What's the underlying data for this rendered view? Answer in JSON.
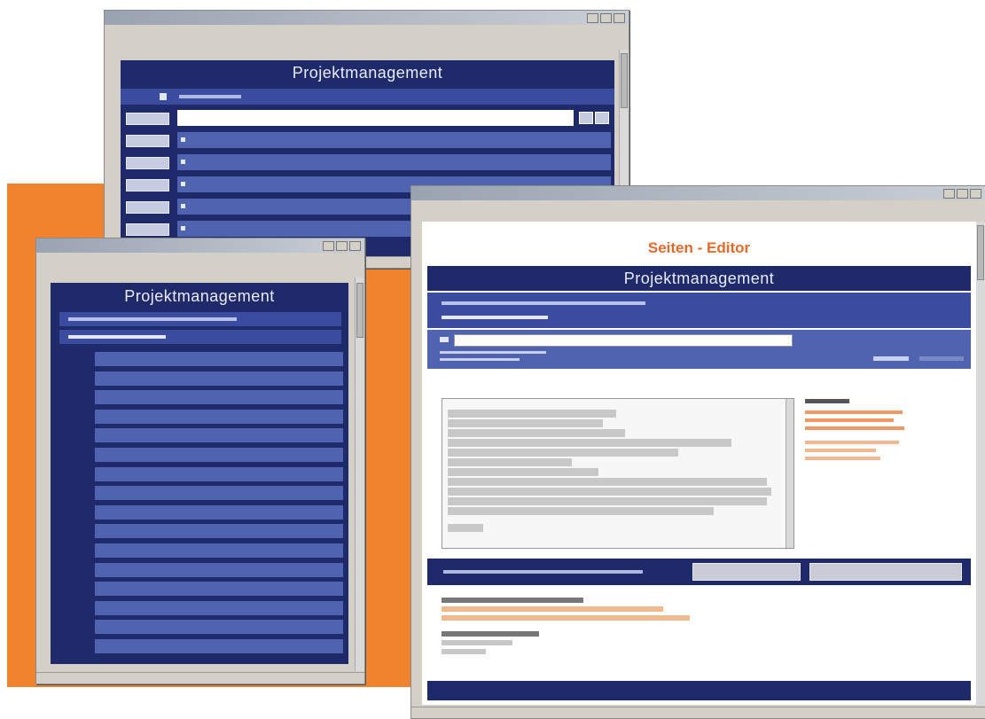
{
  "win_a": {
    "header": "Projektmanagement",
    "rows": [
      {
        "label": ""
      },
      {
        "label": ""
      },
      {
        "label": ""
      },
      {
        "label": ""
      },
      {
        "label": ""
      },
      {
        "label": ""
      }
    ]
  },
  "win_b": {
    "header": "Projektmanagement",
    "rows": [
      {
        "num": "",
        "label": ""
      }
    ]
  },
  "win_c": {
    "editor_title": "Seiten - Editor",
    "header": "Projektmanagement"
  },
  "colors": {
    "navy": "#1f2a6b",
    "panel_blue": "#3b4ca0",
    "light_blue": "#5063b0",
    "orange": "#f0832e",
    "editor_title": "#e46a2a"
  }
}
